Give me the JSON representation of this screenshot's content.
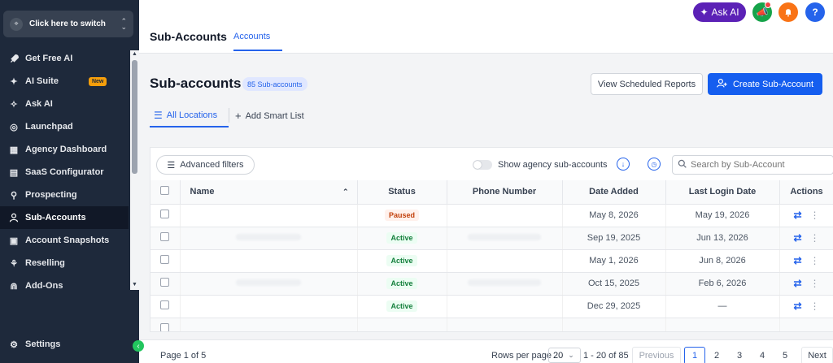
{
  "sidebar": {
    "switcher_label": "Click here to switch",
    "items": [
      {
        "label": "Get Free AI",
        "icon": "rocket-icon",
        "glyph": "🚀"
      },
      {
        "label": "AI Suite",
        "icon": "sparkle-icon",
        "glyph": "✦",
        "badge": "New"
      },
      {
        "label": "Ask AI",
        "icon": "sparkle-icon",
        "glyph": "✧"
      },
      {
        "label": "Launchpad",
        "icon": "launchpad-icon",
        "glyph": "◎"
      },
      {
        "label": "Agency Dashboard",
        "icon": "dashboard-icon",
        "glyph": "▦"
      },
      {
        "label": "SaaS Configurator",
        "icon": "chart-icon",
        "glyph": "▤"
      },
      {
        "label": "Prospecting",
        "icon": "prospecting-icon",
        "glyph": "⚲"
      },
      {
        "label": "Sub-Accounts",
        "icon": "user-icon",
        "glyph": "♙"
      },
      {
        "label": "Account Snapshots",
        "icon": "snapshot-icon",
        "glyph": "▣"
      },
      {
        "label": "Reselling",
        "icon": "network-icon",
        "glyph": "⚘"
      },
      {
        "label": "Add-Ons",
        "icon": "addons-icon",
        "glyph": "⋒"
      }
    ],
    "settings_label": "Settings"
  },
  "header": {
    "app_title": "Sub-Accounts",
    "tab_label": "Accounts",
    "ask_ai_label": "Ask AI",
    "help_label": "?"
  },
  "main": {
    "title": "Sub-accounts",
    "count_badge": "85 Sub-accounts",
    "view_scheduled_label": "View Scheduled Reports",
    "create_label": "Create Sub-Account",
    "tab_all_locations": "All Locations",
    "tab_add_smart_list": "Add Smart List"
  },
  "toolbar": {
    "advanced_filters_label": "Advanced filters",
    "show_agency_label": "Show agency sub-accounts",
    "search_placeholder": "Search by Sub-Account"
  },
  "table": {
    "columns": [
      "Name",
      "Status",
      "Phone Number",
      "Date Added",
      "Last Login Date",
      "Actions"
    ],
    "rows": [
      {
        "status": "Paused",
        "date_added": "May 8, 2026",
        "last_login": "May 19, 2026"
      },
      {
        "status": "Active",
        "date_added": "Sep 19, 2025",
        "last_login": "Jun 13, 2026"
      },
      {
        "status": "Active",
        "date_added": "May 1, 2026",
        "last_login": "Jun 8, 2026"
      },
      {
        "status": "Active",
        "date_added": "Oct 15, 2025",
        "last_login": "Feb 6, 2026"
      },
      {
        "status": "Active",
        "date_added": "Dec 29, 2025",
        "last_login": "—"
      }
    ]
  },
  "footer": {
    "page_info": "Page 1 of 5",
    "rows_per_page_label": "Rows per page",
    "rows_per_page_value": "20",
    "range": "1 - 20 of 85",
    "previous_label": "Previous",
    "next_label": "Next",
    "pages": [
      "1",
      "2",
      "3",
      "4",
      "5"
    ]
  },
  "colors": {
    "accent": "#155eef",
    "sidebar_bg": "#1e293b",
    "ask_ai": "#5b21b6",
    "active_status": "#15803d",
    "paused_status": "#c2410c"
  }
}
